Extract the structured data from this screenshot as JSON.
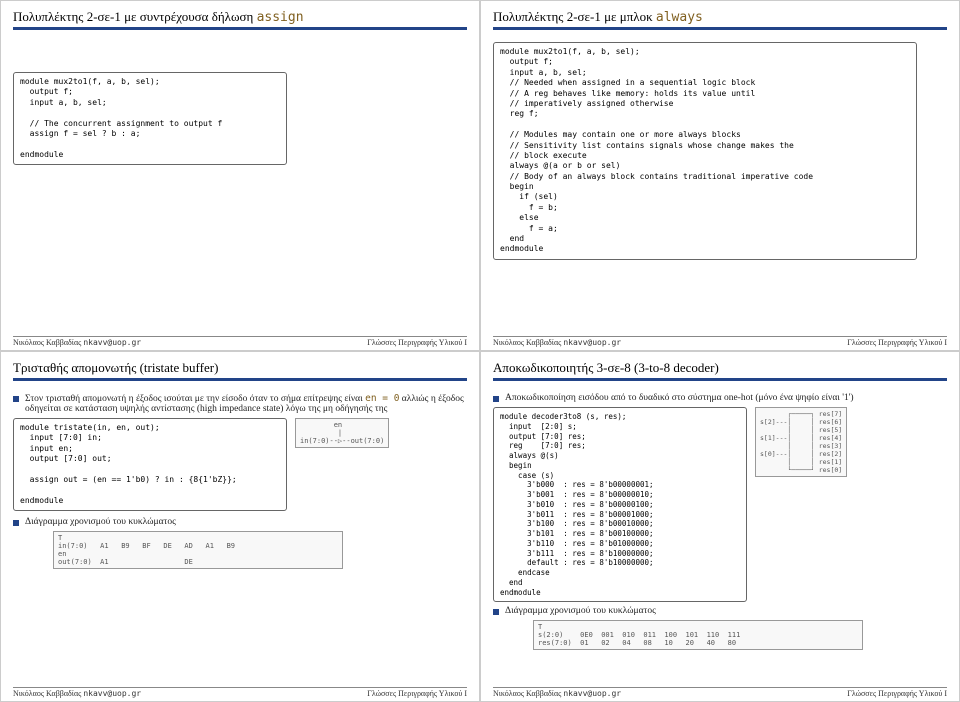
{
  "s1": {
    "title_pre": "Πολυπλέκτης 2-σε-1 με συντρέχουσα δήλωση ",
    "title_kw": "assign",
    "code": "module mux2to1(f, a, b, sel);\n  output f;\n  input a, b, sel;\n\n  // The concurrent assignment to output f\n  assign f = sel ? b : a;\n\nendmodule"
  },
  "s2": {
    "title_pre": "Πολυπλέκτης 2-σε-1 με μπλοκ ",
    "title_kw": "always",
    "code": "module mux2to1(f, a, b, sel);\n  output f;\n  input a, b, sel;\n  // Needed when assigned in a sequential logic block\n  // A reg behaves like memory: holds its value until\n  // imperatively assigned otherwise\n  reg f;\n\n  // Modules may contain one or more always blocks\n  // Sensitivity list contains signals whose change makes the\n  // block execute\n  always @(a or b or sel)\n  // Body of an always block contains traditional imperative code\n  begin\n    if (sel)\n      f = b;\n    else\n      f = a;\n  end\nendmodule"
  },
  "s3": {
    "title": "Τρισταθής απομονωτής (tristate buffer)",
    "bul1_a": "Στον τρισταθή απομονωτή η έξοδος ισούται με την είσοδο όταν το σήμα επίτρεψης είναι ",
    "bul1_en": "en = 0",
    "bul1_b": " αλλιώς η έξοδος οδηγείται σε κατάσταση υψηλής αντίστασης (high impedance state) λόγω της μη οδήγησής της",
    "code": "module tristate(in, en, out);\n  input [7:0] in;\n  input en;\n  output [7:0] out;\n\n  assign out = (en == 1'b0) ? in : {8{1'bZ}};\n\nendmodule",
    "bul2": "Διάγραμμα χρονισμού του κυκλώματος",
    "diag_buf": "        en\n         |\nin(7:0)--▷--out(7:0)",
    "timing": "T\nin(7:0)   A1   B9   BF   DE   AD   A1   B9\nen\nout(7:0)  A1                  DE"
  },
  "s4": {
    "title": "Αποκωδικοποιητής 3-σε-8 (3-to-8 decoder)",
    "bul1": "Αποκωδικοποίηση εισόδου από το δυαδικό στο σύστημα one-hot (μόνο ένα ψηφίο είναι '1')",
    "code": "module decoder3to8 (s, res);\n  input  [2:0] s;\n  output [7:0] res;\n  reg    [7:0] res;\n  always @(s)\n  begin\n    case (s)\n      3'b000  : res = 8'b00000001;\n      3'b001  : res = 8'b00000010;\n      3'b010  : res = 8'b00000100;\n      3'b011  : res = 8'b00001000;\n      3'b100  : res = 8'b00010000;\n      3'b101  : res = 8'b00100000;\n      3'b110  : res = 8'b01000000;\n      3'b111  : res = 8'b10000000;\n      default : res = 8'b10000000;\n    endcase\n  end\nendmodule",
    "bul2": "Διάγραμμα χρονισμού του κυκλώματος",
    "diag_dec": "       ┌─────┐ res[7]\ns[2]---│     │ res[6]\n       │     │ res[5]\ns[1]---│     │ res[4]\n       │     │ res[3]\ns[0]---│     │ res[2]\n       │     │ res[1]\n       └─────┘ res[0]",
    "timing": "T\ns(2:0)    0E0  001  010  011  100  101  110  111\nres(7:0)  01   02   04   08   10   20   40   80"
  },
  "footer": {
    "author": "Νικόλαος Καββαδίας",
    "email": "nkavv@uop.gr",
    "course": "Γλώσσες Περιγραφής Υλικού I"
  }
}
